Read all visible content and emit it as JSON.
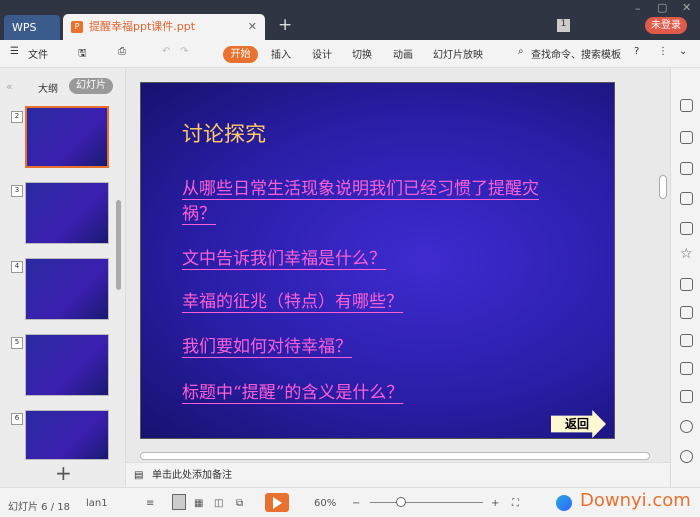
{
  "titlebar": {
    "app_tab": "WPS",
    "doc_tab": "提醒幸福ppt课件.ppt",
    "badge": "1",
    "login": "未登录"
  },
  "toolbar": {
    "file": "文件",
    "tabs": [
      "开始",
      "插入",
      "设计",
      "切换",
      "动画",
      "幻灯片放映"
    ],
    "search": "查找命令、搜索模板",
    "help": "?"
  },
  "leftpanel": {
    "outline": "大纲",
    "slides": "幻灯片",
    "add": "+",
    "thumb_nums": [
      "2",
      "3",
      "4",
      "5",
      "6"
    ]
  },
  "slide": {
    "title": "讨论探究",
    "questions": [
      "从哪些日常生活现象说明我们已经习惯了提醒灾祸？",
      "文中告诉我们幸福是什么？",
      "幸福的征兆（特点）有哪些？",
      "我们要如何对待幸福？",
      "标题中“提醒”的含义是什么？"
    ],
    "back": "返回"
  },
  "notes": {
    "placeholder": "单击此处添加备注"
  },
  "status": {
    "slide_info": "幻灯片 6 / 18",
    "theme": "lan1",
    "zoom": "60%",
    "zoom_level": 60,
    "watermark": "Downyi.com"
  },
  "colors": {
    "accent": "#e8712f",
    "slide_title": "#ffcc66",
    "question": "#ff5fd6"
  }
}
